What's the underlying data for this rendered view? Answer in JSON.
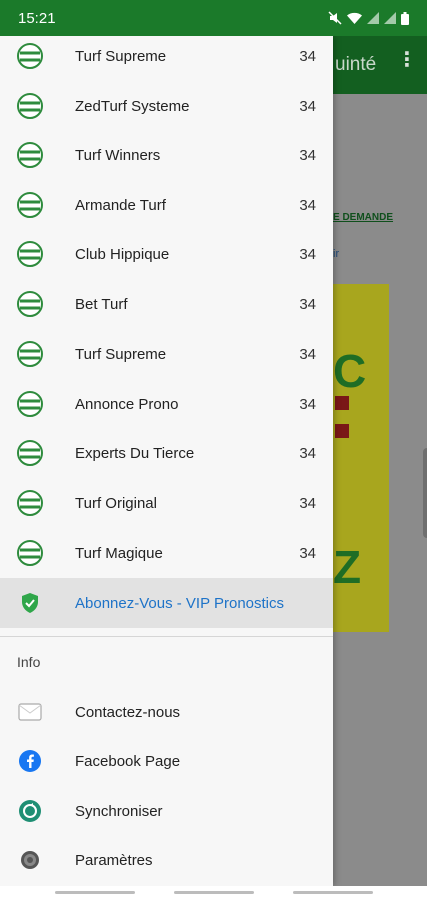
{
  "status_bar": {
    "time": "15:21"
  },
  "background_app": {
    "title": "uinté",
    "link1": "E DEMANDE",
    "link2": "ir"
  },
  "drawer": {
    "items": [
      {
        "label": "Turf Supreme",
        "count": "34",
        "icon": "turf-logo-icon"
      },
      {
        "label": "ZedTurf Systeme",
        "count": "34",
        "icon": "turf-logo-icon"
      },
      {
        "label": "Turf Winners",
        "count": "34",
        "icon": "turf-logo-icon"
      },
      {
        "label": "Armande Turf",
        "count": "34",
        "icon": "turf-logo-icon"
      },
      {
        "label": "Club Hippique",
        "count": "34",
        "icon": "turf-logo-icon"
      },
      {
        "label": "Bet Turf",
        "count": "34",
        "icon": "turf-logo-icon"
      },
      {
        "label": "Turf Supreme",
        "count": "34",
        "icon": "turf-logo-icon"
      },
      {
        "label": "Annonce Prono",
        "count": "34",
        "icon": "turf-logo-icon"
      },
      {
        "label": "Experts Du Tierce",
        "count": "34",
        "icon": "turf-logo-icon"
      },
      {
        "label": "Turf Original",
        "count": "34",
        "icon": "turf-logo-icon"
      },
      {
        "label": "Turf Magique",
        "count": "34",
        "icon": "turf-logo-icon"
      }
    ],
    "vip": {
      "label": "Abonnez-Vous - VIP Pronostics",
      "icon": "shield-check-icon"
    },
    "info_header": "Info",
    "info_items": [
      {
        "label": "Contactez-nous",
        "icon": "mail-icon"
      },
      {
        "label": "Facebook Page",
        "icon": "facebook-icon"
      },
      {
        "label": "Synchroniser",
        "icon": "sync-icon"
      },
      {
        "label": "Paramètres",
        "icon": "settings-icon"
      }
    ]
  },
  "colors": {
    "primary": "#1b7a2a",
    "accent": "#1e73c8"
  }
}
